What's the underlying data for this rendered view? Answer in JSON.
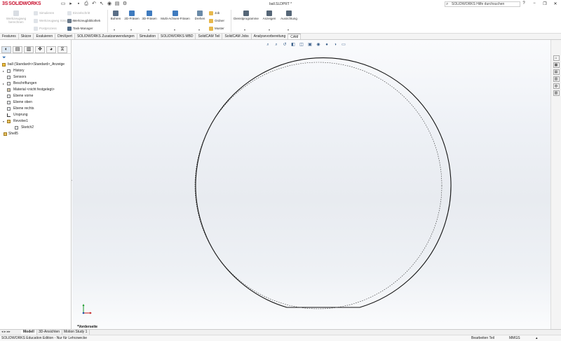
{
  "app": {
    "logo_ds": "3S",
    "logo_text": "SOLIDWORKS",
    "doc_title": "ball.SLDPRT *",
    "help_search_placeholder": "SOLIDWORKS Hilfe durchsuchen",
    "window_buttons": [
      "?",
      "−",
      "❐",
      "✕"
    ]
  },
  "ribbon": {
    "left_big": {
      "label1": "Werkzeugweg",
      "label2": "berechnen"
    },
    "col1": [
      "Simulieren",
      "Werkzeugweg Simulation",
      "Postprozess"
    ],
    "col2": [
      "Einzelschritt",
      "Werkzeugbibliothek",
      "Task-Manager"
    ],
    "big_buttons": [
      "Bohren",
      "2D-Fräsen",
      "3D-Fräsen",
      "Multi-Achsen-Fräsen",
      "Drehen"
    ],
    "col3": [
      "Job",
      "Ordner",
      "Muster"
    ],
    "right_buttons": [
      "Dienstprogramme",
      "Anzeigen",
      "Ausrichtung"
    ]
  },
  "tabs": [
    {
      "label": "Features",
      "active": false
    },
    {
      "label": "Skizze",
      "active": false
    },
    {
      "label": "Evaluieren",
      "active": false
    },
    {
      "label": "DimXpert",
      "active": false
    },
    {
      "label": "SOLIDWORKS Zusatzanwendungen",
      "active": false
    },
    {
      "label": "Simulation",
      "active": false
    },
    {
      "label": "SOLIDWORKS MBD",
      "active": false
    },
    {
      "label": "SolidCAM Teil",
      "active": false
    },
    {
      "label": "SolidCAM Jobs",
      "active": false
    },
    {
      "label": "Analysevorbereitung",
      "active": false
    },
    {
      "label": "CAM",
      "active": true
    }
  ],
  "feature_tree": {
    "root": "ball (Standard<<Standard>_Anzeige",
    "items": [
      {
        "label": "History",
        "expander": "▸",
        "indent": 1
      },
      {
        "label": "Sensors",
        "expander": "",
        "indent": 1
      },
      {
        "label": "Beschriftungen",
        "expander": "▸",
        "indent": 1
      },
      {
        "label": "Material <nicht festgelegt>",
        "expander": "",
        "indent": 1
      },
      {
        "label": "Ebene vorne",
        "expander": "",
        "indent": 1
      },
      {
        "label": "Ebene oben",
        "expander": "",
        "indent": 1
      },
      {
        "label": "Ebene rechts",
        "expander": "",
        "indent": 1
      },
      {
        "label": "Ursprung",
        "expander": "",
        "indent": 1
      },
      {
        "label": "Revolve1",
        "expander": "▾",
        "indent": 1
      },
      {
        "label": "Sketch2",
        "expander": "",
        "indent": 2
      },
      {
        "label": "Shell5",
        "expander": "",
        "indent": 0
      }
    ]
  },
  "viewport": {
    "view_label": "*Vorderseite"
  },
  "bottom_tabs": {
    "nav": "◂ ▸ ▸▸",
    "tabs": [
      "Modell",
      "3D-Ansichten",
      "Motion Study 1"
    ],
    "active": "Modell"
  },
  "status": {
    "left": "SOLIDWORKS Education Edition - Nur für Lehrzwecke",
    "mode": "Bearbeiten Teil",
    "units": "MMGS",
    "cfg": "▴"
  },
  "colors": {
    "brand": "#c8102e",
    "accent": "#2a6ab0"
  }
}
